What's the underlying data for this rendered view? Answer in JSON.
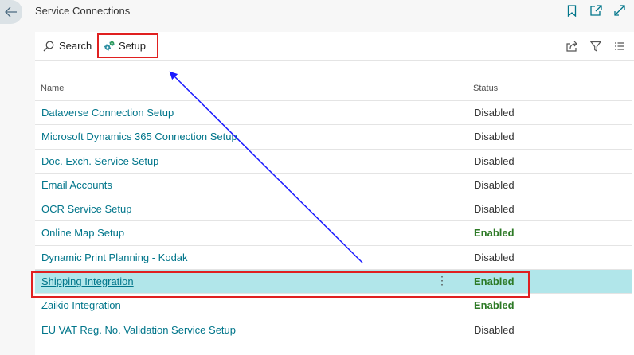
{
  "header": {
    "title": "Service Connections",
    "back_icon": "arrow-left-icon",
    "actions": [
      "bookmark-icon",
      "open-new-window-icon",
      "expand-icon"
    ]
  },
  "toolbar": {
    "search_label": "Search",
    "setup_label": "Setup",
    "right_actions": [
      "share-icon",
      "filter-icon",
      "list-view-icon"
    ]
  },
  "table": {
    "columns": {
      "name": "Name",
      "status": "Status"
    },
    "rows": [
      {
        "name": "Dataverse Connection Setup",
        "status": "Disabled"
      },
      {
        "name": "Microsoft Dynamics 365 Connection Setup",
        "status": "Disabled"
      },
      {
        "name": "Doc. Exch. Service Setup",
        "status": "Disabled"
      },
      {
        "name": "Email Accounts",
        "status": "Disabled"
      },
      {
        "name": "OCR Service Setup",
        "status": "Disabled"
      },
      {
        "name": "Online Map Setup",
        "status": "Enabled"
      },
      {
        "name": "Dynamic Print Planning - Kodak",
        "status": "Disabled"
      },
      {
        "name": "Shipping Integration",
        "status": "Enabled",
        "selected": true
      },
      {
        "name": "Zaikio Integration",
        "status": "Enabled"
      },
      {
        "name": "EU VAT Reg. No. Validation Service Setup",
        "status": "Disabled"
      }
    ]
  },
  "colors": {
    "link": "#00758a",
    "enabled": "#2d7a26",
    "selected_row": "#b1e6ea",
    "highlight_box": "#e02020",
    "annotation_arrow": "#1a1aff"
  }
}
